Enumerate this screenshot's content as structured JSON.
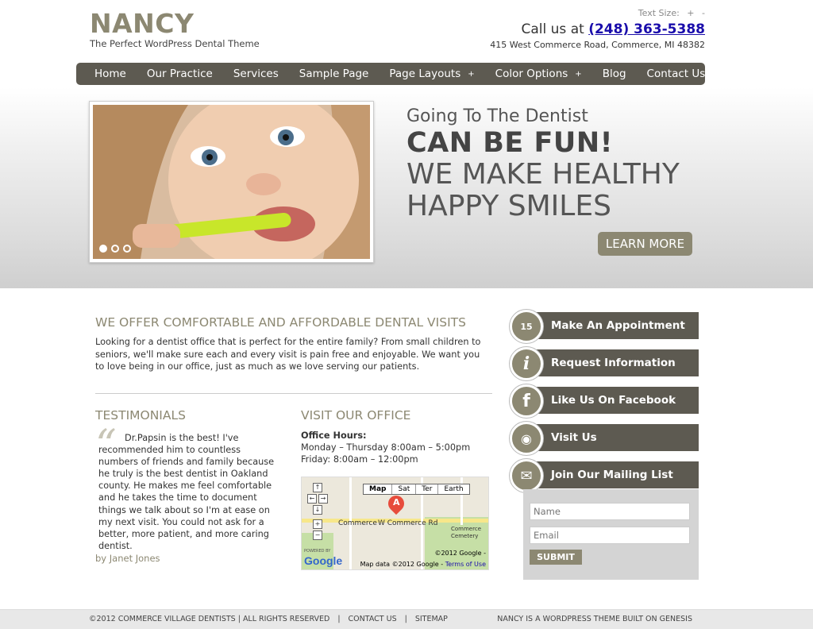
{
  "header": {
    "logo_title": "NANCY",
    "logo_subtitle": "The Perfect WordPress Dental Theme",
    "text_size_label": "Text Size:",
    "text_size_plus": "+",
    "text_size_minus": "-",
    "call_us_label": "Call us at",
    "phone": "(248) 363-5388",
    "address": "415 West Commerce Road, Commerce, MI 48382"
  },
  "nav": {
    "items": [
      {
        "label": "Home"
      },
      {
        "label": "Our Practice"
      },
      {
        "label": "Services"
      },
      {
        "label": "Sample Page"
      },
      {
        "label": "Page Layouts",
        "submenu": "+"
      },
      {
        "label": "Color Options",
        "submenu": "+"
      },
      {
        "label": "Blog"
      },
      {
        "label": "Contact Us"
      }
    ]
  },
  "hero": {
    "line1": "Going To The Dentist",
    "line2": "CAN BE FUN!",
    "line3": "WE MAKE HEALTHY",
    "line4": "HAPPY SMILES",
    "button": "LEARN MORE",
    "slide_count": 3,
    "active_slide": 1
  },
  "main": {
    "offer_title": "WE OFFER COMFORTABLE AND AFFORDABLE DENTAL VISITS",
    "offer_text": "Looking for a dentist office that is perfect for the entire family? From small children to seniors, we'll make sure each and every visit is pain free and enjoyable. We want you to love being in our office, just as much as we love serving our patients.",
    "testimonials_title": "TESTIMONIALS",
    "quote": "Dr.Papsin is the best! I've recommended him to countless numbers of friends and family because he truly is the best dentist in Oakland county. He makes me feel comfortable and he takes the time to document things we talk about so I'm at ease on my next visit. You could not ask for a better, more patient, and more caring dentist.",
    "quote_by": "by Janet Jones",
    "visit_title": "VISIT OUR OFFICE",
    "office_hours_label": "Office Hours:",
    "hours_1": "Monday – Thursday 8:00am – 5:00pm",
    "hours_2": "Friday: 8:00am – 12:00pm"
  },
  "map": {
    "types": [
      "Map",
      "Sat",
      "Ter",
      "Earth"
    ],
    "selected_type": "Map",
    "pin_label": "A",
    "street_1": "Commerce",
    "street_2": "W Commerce Rd",
    "cemetery": "Commerce Cemetery",
    "powered_by": "POWERED BY",
    "google": "Google",
    "copyright": "©2012 Google -",
    "map_data": "Map data ©2012 Google -",
    "terms": "Terms of Use"
  },
  "sidebar": {
    "buttons": [
      {
        "label": "Make An Appointment",
        "icon": "calendar-icon",
        "icon_text": "15"
      },
      {
        "label": "Request Information",
        "icon": "info-icon",
        "icon_text": "i"
      },
      {
        "label": "Like Us On Facebook",
        "icon": "facebook-icon",
        "icon_text": "f"
      },
      {
        "label": "Visit Us",
        "icon": "location-icon",
        "icon_text": "◉"
      },
      {
        "label": "Join Our Mailing List",
        "icon": "envelope-icon",
        "icon_text": "✉"
      }
    ],
    "name_placeholder": "Name",
    "email_placeholder": "Email",
    "submit": "SUBMIT"
  },
  "footer": {
    "copyright": "©2012 COMMERCE VILLAGE DENTISTS | ALL RIGHTS RESERVED",
    "contact": "CONTACT US",
    "sitemap": "SITEMAP",
    "credit": "NANCY IS A WORDPRESS THEME BUILT ON GENESIS",
    "separator": "|"
  },
  "colors": {
    "brand": "#8c8872",
    "nav": "#5d5a51",
    "link": "#1a0dab"
  }
}
